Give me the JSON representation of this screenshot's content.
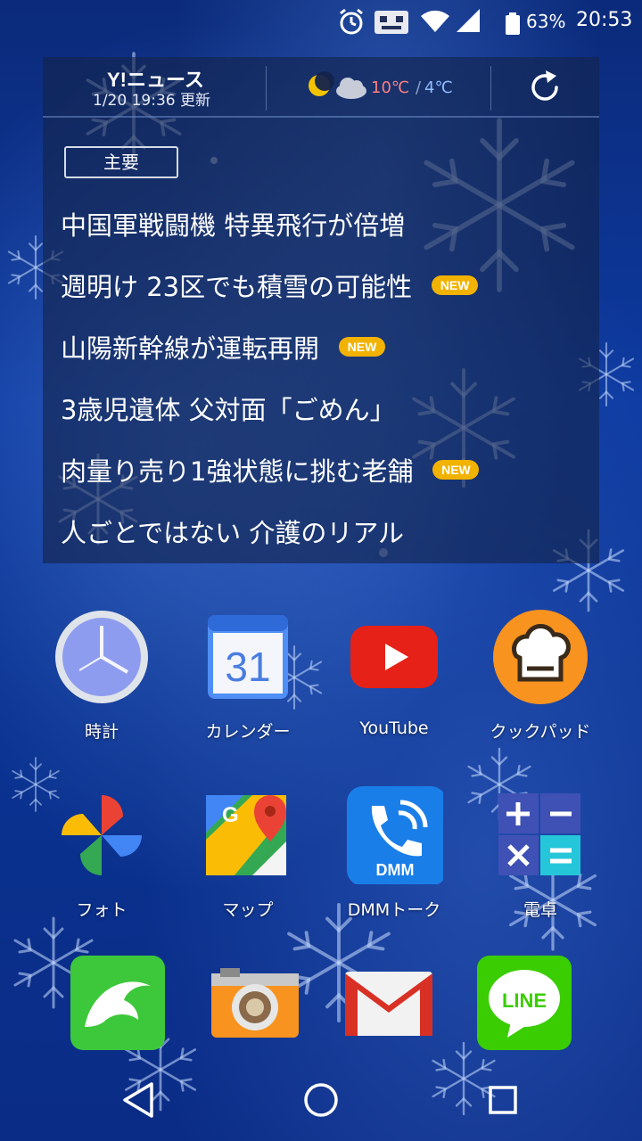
{
  "status_bar": {
    "icons": [
      "alarm-icon",
      "notification-robot-icon",
      "wifi-icon",
      "signal-icon",
      "battery-icon"
    ],
    "battery": "63%",
    "time": "20:53"
  },
  "widget": {
    "logo": "Y!ニュース",
    "updated": "1/20 19:36 更新",
    "weather_icon": "moon-cloud-icon",
    "temp_high": "10℃",
    "temp_low": "4℃",
    "refresh_icon": "refresh-icon",
    "tab": "主要",
    "news": [
      {
        "title": "中国軍戦闘機 特異飛行が倍増",
        "badge": ""
      },
      {
        "title": "週明け 23区でも積雪の可能性",
        "badge": "NEW"
      },
      {
        "title": "山陽新幹線が運転再開",
        "badge": "NEW"
      },
      {
        "title": "3歳児遺体 父対面「ごめん」",
        "badge": ""
      },
      {
        "title": "肉量り売り1強状態に挑む老舗",
        "badge": "NEW"
      },
      {
        "title": "人ごとではない 介護のリアル",
        "badge": ""
      }
    ]
  },
  "apps": [
    {
      "label": "時計",
      "icon": "clock-icon"
    },
    {
      "label": "カレンダー",
      "icon": "calendar-icon",
      "icon_text": "31"
    },
    {
      "label": "YouTube",
      "icon": "youtube-icon"
    },
    {
      "label": "クックパッド",
      "icon": "cookpad-icon"
    },
    {
      "label": "フォト",
      "icon": "photos-icon"
    },
    {
      "label": "マップ",
      "icon": "maps-icon"
    },
    {
      "label": "DMMトーク",
      "icon": "dmm-talk-icon",
      "icon_text": "DMM"
    },
    {
      "label": "電卓",
      "icon": "calculator-icon"
    }
  ],
  "dock": [
    {
      "icon": "dolphin-browser-icon"
    },
    {
      "icon": "camera-icon"
    },
    {
      "icon": "gmail-icon"
    },
    {
      "icon": "line-icon",
      "icon_text": "LINE"
    }
  ],
  "nav": {
    "back": "back-icon",
    "home": "home-icon",
    "recents": "recents-icon"
  },
  "colors": {
    "badge": "#f2b200",
    "temp_high": "#ff7f7f",
    "temp_low": "#8fbdff",
    "wallpaper": "#0d3aa0"
  }
}
